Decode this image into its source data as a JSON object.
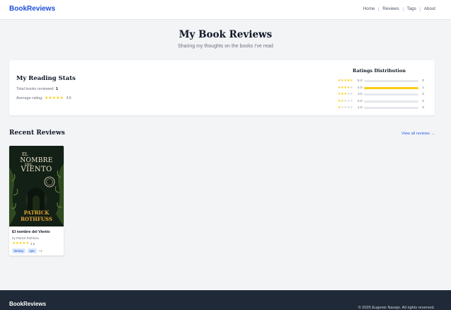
{
  "header": {
    "brand": "BookReviews",
    "nav": [
      "Home",
      "Reviews",
      "Tags",
      "About"
    ]
  },
  "hero": {
    "title": "My Book Reviews",
    "subtitle": "Sharing my thoughts on the books I've read"
  },
  "stats": {
    "title": "My Reading Stats",
    "total_label": "Total books reviewed:",
    "total_value": "1",
    "avg_label": "Average rating:",
    "avg_value": "4.5",
    "avg_numeric": 4.5
  },
  "distribution": {
    "title": "Ratings Distribution",
    "rows": [
      {
        "label": "5.0",
        "stars": 5,
        "count": "0",
        "fraction": 0
      },
      {
        "label": "4.0",
        "stars": 4,
        "count": "1",
        "fraction": 1
      },
      {
        "label": "3.0",
        "stars": 3,
        "count": "0",
        "fraction": 0
      },
      {
        "label": "2.0",
        "stars": 2,
        "count": "0",
        "fraction": 0
      },
      {
        "label": "1.0",
        "stars": 1,
        "count": "0",
        "fraction": 0
      }
    ],
    "accent": "#facc15"
  },
  "recent": {
    "title": "Recent Reviews",
    "view_all": "View all reviews →",
    "books": [
      {
        "title": "El nombre del Viento",
        "author": "by Patrick Rothfuss",
        "rating": "4.5",
        "rating_numeric": 4.5,
        "tags": [
          "fantasy",
          "epic"
        ],
        "more": "+1",
        "cover": {
          "line1": "EL",
          "line2": "NOMBRE",
          "line3": "DEL",
          "line4": "VIENTO",
          "author_first": "PATRICK",
          "author_last": "ROTHFUSS"
        }
      }
    ]
  },
  "footer": {
    "brand": "BookReviews",
    "copyright": "© 2025 Eugenio Navajo. All rights reserved."
  },
  "colors": {
    "brand": "#1d4ed8",
    "link": "#2563eb",
    "star": "#facc15",
    "footer_bg": "#1f2937"
  }
}
